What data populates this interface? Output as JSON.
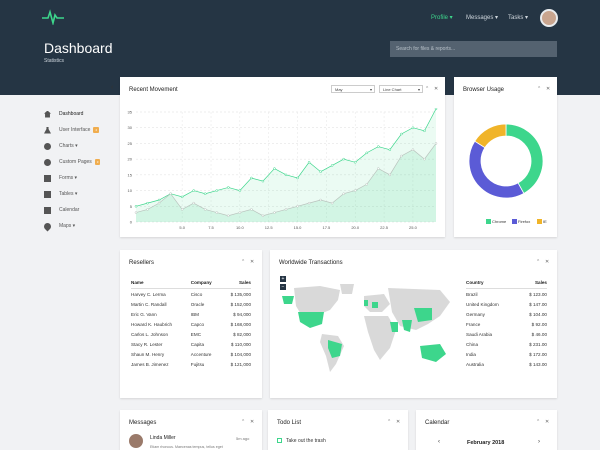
{
  "header": {
    "nav": [
      {
        "label": "Profile ▾"
      },
      {
        "label": "Messages ▾"
      },
      {
        "label": "Tasks ▾"
      }
    ],
    "title": "Dashboard",
    "subtitle": "Statistics",
    "search_placeholder": "Search for files & reports..."
  },
  "colors": {
    "header_bg": "#253544",
    "accent": "#3dd68c",
    "chrome": "#3dd68c",
    "firefox": "#5b5bd6",
    "ie": "#f0b429"
  },
  "sidebar": {
    "items": [
      {
        "label": "Dashboard",
        "icon": "home-icon"
      },
      {
        "label": "User Interface",
        "icon": "flask-icon",
        "badge": "4"
      },
      {
        "label": "Charts ▾",
        "icon": "pie-icon"
      },
      {
        "label": "Custom Pages",
        "icon": "circle-icon",
        "badge": "3"
      },
      {
        "label": "Forms ▾",
        "icon": "list-icon"
      },
      {
        "label": "Tables ▾",
        "icon": "table-icon"
      },
      {
        "label": "Calendar",
        "icon": "calendar-icon"
      },
      {
        "label": "Maps ▾",
        "icon": "marker-icon"
      }
    ]
  },
  "movement": {
    "title": "Recent Movement",
    "period": "May",
    "chart_kind": "Line Chart"
  },
  "chart_data": {
    "type": "area",
    "title": "Recent Movement",
    "xlabel": "",
    "ylabel": "",
    "x_ticks": [
      "5.0",
      "7.5",
      "10.0",
      "12.5",
      "15.0",
      "17.5",
      "20.0",
      "22.5",
      "25.0"
    ],
    "y_ticks": [
      "0",
      "5",
      "10",
      "15",
      "20",
      "25",
      "30",
      "35"
    ],
    "xlim": [
      1,
      27
    ],
    "ylim": [
      0,
      35
    ],
    "grid": "dashed",
    "series": [
      {
        "x": [
          1,
          2,
          3,
          4,
          5,
          6,
          7,
          8,
          9,
          10,
          11,
          12,
          13,
          14,
          15,
          16,
          17,
          18,
          19,
          20,
          21,
          22,
          23,
          24,
          25,
          26,
          27
        ],
        "values": [
          5,
          6,
          7,
          9,
          8,
          10,
          9,
          10,
          11,
          10,
          14,
          13,
          17,
          15,
          14,
          19,
          16,
          18,
          20,
          19,
          22,
          24,
          23,
          28,
          30,
          29,
          36
        ]
      },
      {
        "x": [
          1,
          2,
          3,
          4,
          5,
          6,
          7,
          8,
          9,
          10,
          11,
          12,
          13,
          14,
          15,
          16,
          17,
          18,
          19,
          20,
          21,
          22,
          23,
          24,
          25,
          26,
          27
        ],
        "values": [
          3,
          4,
          6,
          9,
          4,
          6,
          4,
          3,
          2,
          3,
          4,
          2,
          3,
          4,
          5,
          6,
          7,
          6,
          9,
          10,
          12,
          17,
          15,
          21,
          23,
          20,
          25
        ]
      }
    ]
  },
  "browser": {
    "title": "Browser Usage",
    "donut": [
      {
        "name": "Chrome",
        "value": 42
      },
      {
        "name": "Firefox",
        "value": 42
      },
      {
        "name": "IE",
        "value": 16
      }
    ]
  },
  "resellers": {
    "title": "Resellers",
    "headers": [
      "Name",
      "Company",
      "Sales"
    ],
    "rows": [
      [
        "Harvey C. Lerma",
        "Cisco",
        "$ 135,000"
      ],
      [
        "Martin C. Randall",
        "Oracle",
        "$ 152,000"
      ],
      [
        "Eric G. Vann",
        "IBM",
        "$ 94,000"
      ],
      [
        "Howard K. Haubrich",
        "Capco",
        "$ 168,000"
      ],
      [
        "Carlos L. Johnson",
        "EMC",
        "$ 82,000"
      ],
      [
        "Stacy R. Lester",
        "Capita",
        "$ 110,000"
      ],
      [
        "Shaun M. Henry",
        "Accenture",
        "$ 104,000"
      ],
      [
        "James B. Jimenez",
        "Fujitsu",
        "$ 121,000"
      ]
    ]
  },
  "worldwide": {
    "title": "Worldwide Transactions",
    "zoom_in": "+",
    "zoom_out": "−",
    "headers": [
      "Country",
      "Sales"
    ],
    "rows": [
      [
        "Brazil",
        "$ 123.00"
      ],
      [
        "United Kingdom",
        "$ 147.00"
      ],
      [
        "Germany",
        "$ 104.00"
      ],
      [
        "France",
        "$ 92.00"
      ],
      [
        "Saudi Arabia",
        "$ 46.00"
      ],
      [
        "China",
        "$ 231.00"
      ],
      [
        "India",
        "$ 172.00"
      ],
      [
        "Australia",
        "$ 143.00"
      ]
    ]
  },
  "messages": {
    "title": "Messages",
    "name": "Linda Miller",
    "time": "5m ago",
    "text": "Etiam rhoncus. Maecenas tempus, tellus eget"
  },
  "todo": {
    "title": "Todo List",
    "item": "Take out the trash"
  },
  "calendar": {
    "title": "Calendar",
    "month": "February 2018"
  },
  "controls": {
    "collapse": "⌃",
    "close": "✕",
    "sidebar_toggle": "‹"
  }
}
